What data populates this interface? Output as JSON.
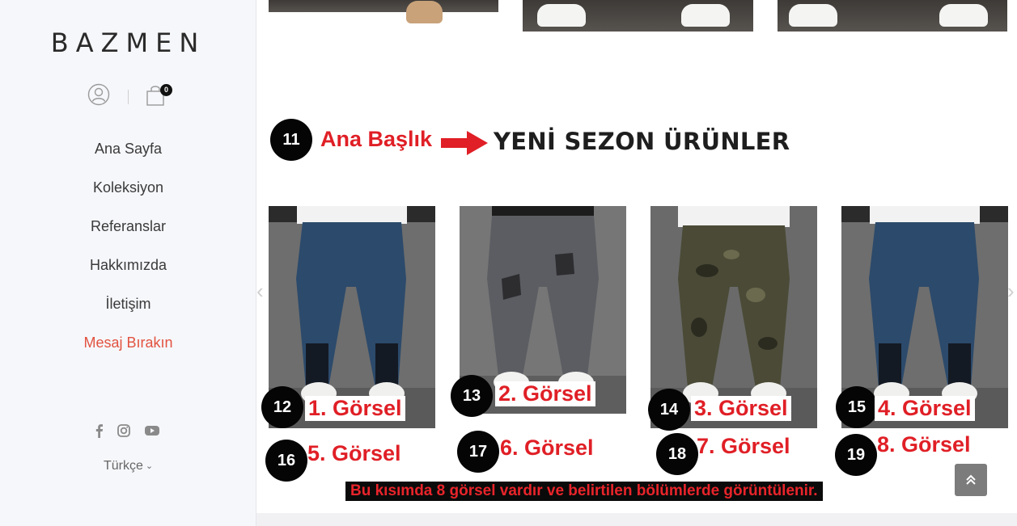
{
  "sidebar": {
    "logo": "BAZMEN",
    "cart_count": "0",
    "nav": [
      {
        "label": "Ana Sayfa"
      },
      {
        "label": "Koleksiyon"
      },
      {
        "label": "Referanslar"
      },
      {
        "label": "Hakkımızda"
      },
      {
        "label": "İletişim"
      },
      {
        "label": "Mesaj Bırakın"
      }
    ],
    "social_icons": [
      "facebook-icon",
      "instagram-icon",
      "youtube-icon"
    ],
    "language": "Türkçe",
    "accent_color": "#e2523f"
  },
  "main": {
    "annotation_header": {
      "number": "11",
      "label": "Ana Başlık"
    },
    "section_title": "YENİ SEZON ÜRÜNLER",
    "products": [
      {
        "name": "product-image-1",
        "variant": "blue-jeans"
      },
      {
        "name": "product-image-2",
        "variant": "grey-ripped-jeans"
      },
      {
        "name": "product-image-3",
        "variant": "camo-cargo"
      },
      {
        "name": "product-image-4",
        "variant": "blue-jeans"
      }
    ],
    "image_annotations": [
      {
        "number": "12",
        "label": "1. Görsel"
      },
      {
        "number": "13",
        "label": "2. Görsel"
      },
      {
        "number": "14",
        "label": "3. Görsel"
      },
      {
        "number": "15",
        "label": "4. Görsel"
      },
      {
        "number": "16",
        "label": "5. Görsel"
      },
      {
        "number": "17",
        "label": "6. Görsel"
      },
      {
        "number": "18",
        "label": "7. Görsel"
      },
      {
        "number": "19",
        "label": "8. Görsel"
      }
    ],
    "footer_note": "Bu kısımda 8 görsel vardır ve belirtilen bölümlerde görüntülenir.",
    "annotation_color": "#e01f26"
  }
}
